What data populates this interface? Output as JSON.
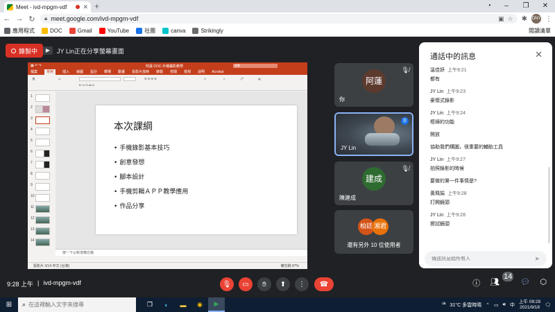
{
  "browser": {
    "tab_title": "Meet - ivd-mpgm-vdf",
    "url": "meet.google.com/ivd-mpgm-vdf",
    "profile_initials": "DNY",
    "bookmarks": [
      {
        "label": "應用程式",
        "color": "#5f6368"
      },
      {
        "label": "DOC",
        "color": "#fbbc04"
      },
      {
        "label": "Gmail",
        "color": "#ea4335"
      },
      {
        "label": "YouTube",
        "color": "#ff0000"
      },
      {
        "label": "社團",
        "color": "#1a73e8"
      },
      {
        "label": "canva",
        "color": "#00c4cc"
      },
      {
        "label": "Strikingly",
        "color": "#6b6b6b"
      }
    ],
    "reading_list": "閱讀清單"
  },
  "meet": {
    "recording_label": "錄製中",
    "presenting_banner": "JY Lin正在分享螢幕畫面",
    "time": "9:28 上午",
    "meeting_code": "ivd-mpgm-vdf",
    "people_count": "14"
  },
  "shared_screen": {
    "app_title": "阿蓮 DOC-手機攝影教學",
    "search_placeholder": "搜尋",
    "ribbon_tabs": [
      "檔案",
      "常用",
      "插入",
      "繪圖",
      "設計",
      "轉場",
      "動畫",
      "投影片放映",
      "錄製",
      "校閱",
      "檢視",
      "說明",
      "Acrobat"
    ],
    "active_ribbon_tab": "常用",
    "slide_title": "本次課綱",
    "bullets": [
      "手機錄影基本技巧",
      "創意發想",
      "腳本設計",
      "手機剪輯ＡＰＰ教學應用",
      "作品分享"
    ],
    "notes_placeholder": "按一下以新增備忘稿",
    "status_left": "投影片 3/14    中文 (台灣)",
    "status_right": "備忘稿    87%",
    "thumb_numbers": [
      "1",
      "2",
      "3",
      "4",
      "5",
      "6",
      "7",
      "8",
      "9",
      "10",
      "11",
      "12",
      "13",
      "14"
    ]
  },
  "participants": [
    {
      "name": "你",
      "initials": "阿蓮",
      "avatar_color": "#5d3a2e",
      "muted": true
    },
    {
      "name": "JY Lin",
      "speaking": true
    },
    {
      "name": "陳建成",
      "initials": "建成",
      "avatar_color": "#2e6b30",
      "muted": true
    },
    {
      "others_label": "還有另外 10 位使用者",
      "initials_a": "柏廷",
      "initials_b": "湘君"
    }
  ],
  "chat": {
    "header": "通話中的訊息",
    "input_placeholder": "傳送訊息給所有人",
    "messages": [
      {
        "sender": "溫佳妤",
        "time": "上午9:21",
        "lines": [
          "都有"
        ]
      },
      {
        "sender": "JY Lin",
        "time": "上午9:23",
        "lines": [
          "豪懷式錄影"
        ]
      },
      {
        "sender": "JY Lin",
        "time": "上午9:24",
        "lines": [
          "梧掃的功能",
          "開放",
          "協助我們構圖，很重要的輔助工具"
        ]
      },
      {
        "sender": "JY Lin",
        "time": "上午9:27",
        "lines": [
          "拍照錄影的時候",
          "要做的第一件事情是?"
        ]
      },
      {
        "sender": "黃珮娟",
        "time": "上午9:28",
        "lines": [
          "打開鏡頭"
        ]
      },
      {
        "sender": "JY Lin",
        "time": "上午9:28",
        "lines": [
          "擦拭鏡頭"
        ]
      }
    ]
  },
  "taskbar": {
    "search_placeholder": "在這裡輸入文字來搜尋",
    "weather": "31°C  多雲時晴",
    "ime": "中",
    "clock_time": "上午 09:28",
    "clock_date": "2021/9/18"
  }
}
